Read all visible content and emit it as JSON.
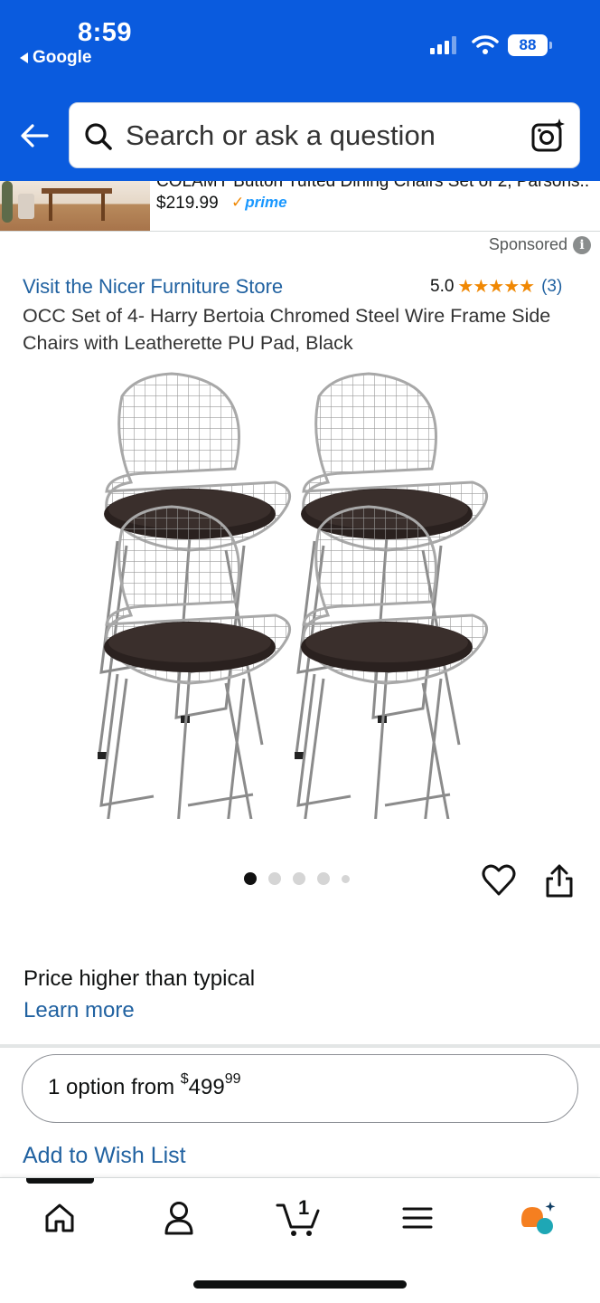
{
  "status_bar": {
    "time": "8:59",
    "back_app": "Google",
    "battery": "88",
    "icons": [
      "signal-icon",
      "wifi-icon",
      "battery-icon"
    ]
  },
  "search": {
    "placeholder": "Search or ask a question",
    "icons": [
      "back-arrow-icon",
      "search-icon",
      "camera-icon"
    ]
  },
  "banner": {
    "title": "COLAMY Button Tufted Dining Chairs Set of 2, Parsons...",
    "price": "$219.99",
    "prime_label": "prime"
  },
  "product": {
    "sponsored_label": "Sponsored",
    "store_link": "Visit the Nicer Furniture Store",
    "rating_value": "5.0",
    "stars": "★★★★★",
    "rating_count": "(3)",
    "title": "OCC Set of 4- Harry Bertoia Chromed Steel Wire Frame Side Chairs with Leatherette PU Pad, Black",
    "image_count": 5,
    "active_image": 1,
    "price_note": "Price higher than typical",
    "learn_more": "Learn more",
    "option_prefix": "1 option from ",
    "option_currency": "$",
    "option_whole": "499",
    "option_fraction": "99",
    "wishlist": "Add to Wish List"
  },
  "bottom_nav": {
    "items": [
      "home-icon",
      "account-icon",
      "cart-icon",
      "menu-icon",
      "rufus-icon"
    ],
    "cart_count": "1"
  },
  "colors": {
    "header_blue": "#0a5bde",
    "link_blue": "#2162a1",
    "star_orange": "#f08804",
    "prime_blue": "#1a98ff"
  }
}
